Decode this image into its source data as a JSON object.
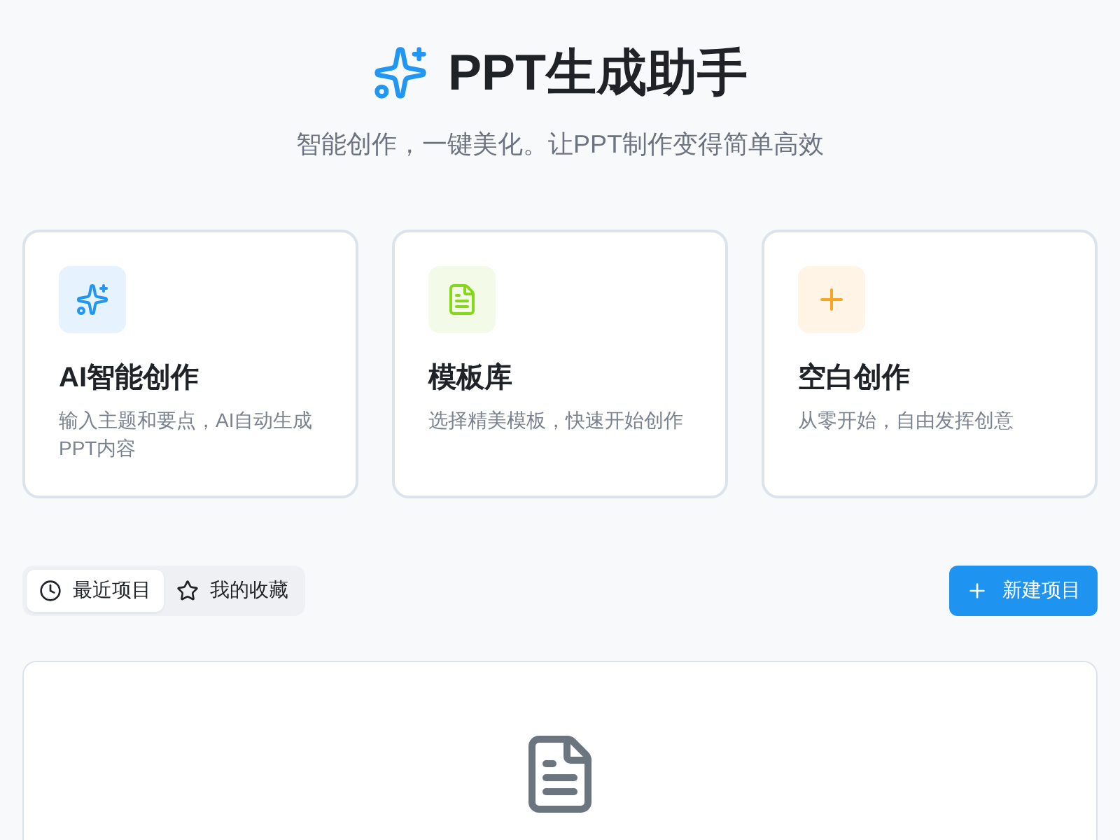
{
  "header": {
    "title": "PPT生成助手",
    "subtitle": "智能创作，一键美化。让PPT制作变得简单高效"
  },
  "cards": [
    {
      "kind": "ai",
      "title": "AI智能创作",
      "description": "输入主题和要点，AI自动生成PPT内容"
    },
    {
      "kind": "template",
      "title": "模板库",
      "description": "选择精美模板，快速开始创作"
    },
    {
      "kind": "blank",
      "title": "空白创作",
      "description": "从零开始，自由发挥创意"
    }
  ],
  "tabs": [
    {
      "kind": "recent",
      "label": "最近项目",
      "selected": true
    },
    {
      "kind": "favorites",
      "label": "我的收藏",
      "selected": false
    }
  ],
  "new_project_button": {
    "label": "新建项目"
  }
}
